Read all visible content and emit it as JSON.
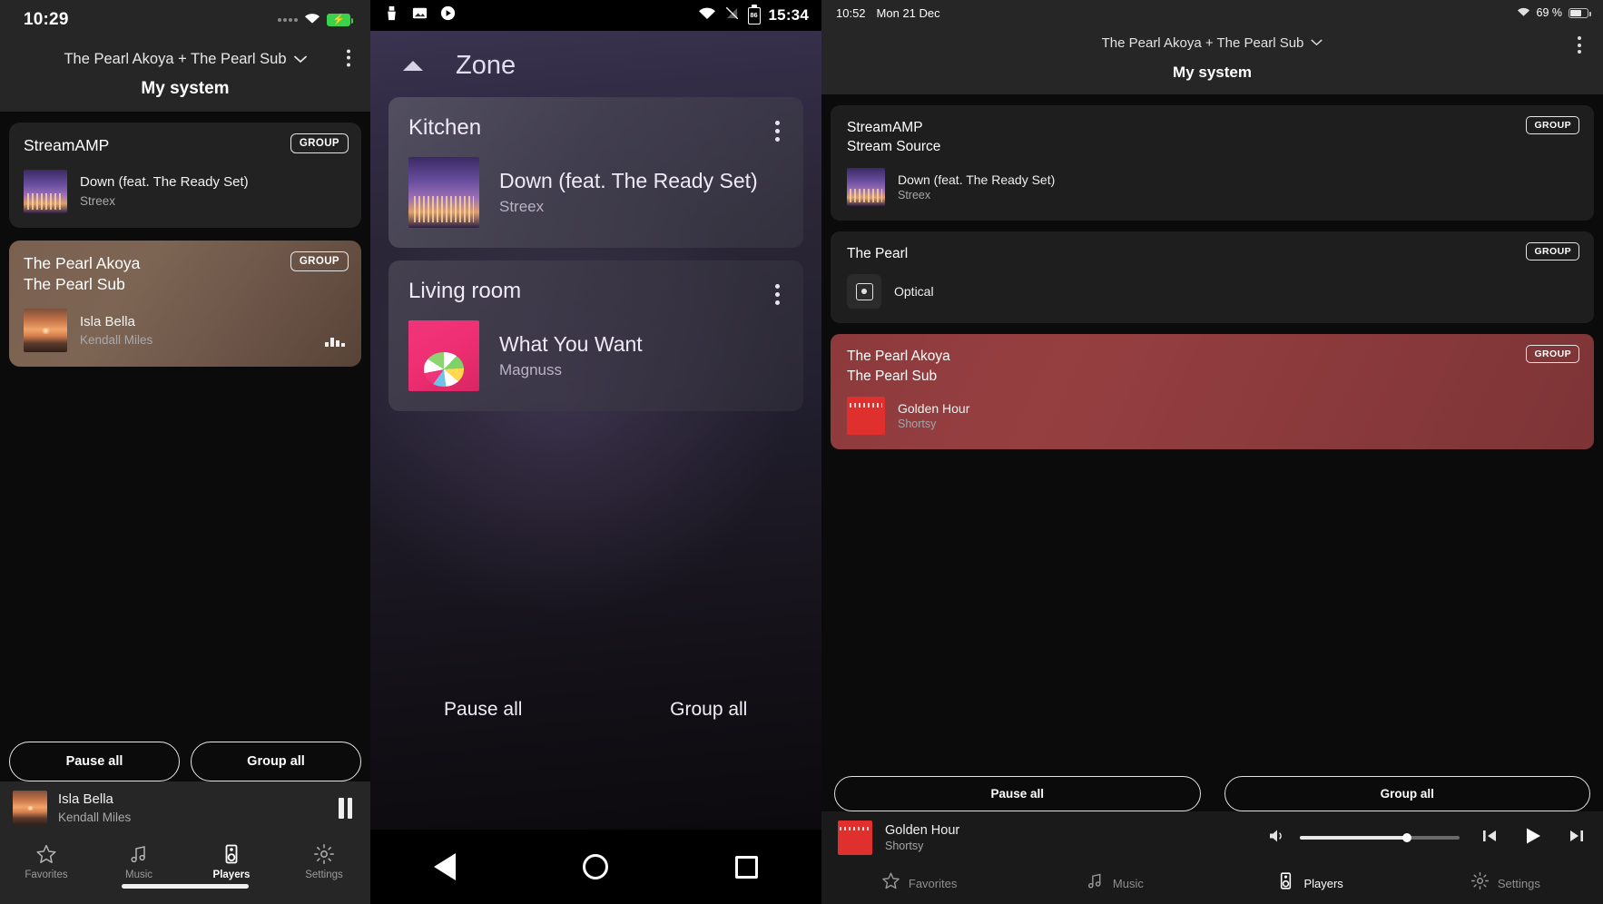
{
  "panel1": {
    "status": {
      "clock": "10:29",
      "wifi_icon": "wifi-icon",
      "signal_icon": "signal-dots-icon",
      "battery_icon": "battery-charging-icon"
    },
    "header": {
      "system_selector": "The Pearl Akoya + The Pearl Sub",
      "chevron": "⌄",
      "menu_icon": "kebab-menu-icon",
      "page_title": "My system"
    },
    "cards": [
      {
        "name": "StreamAMP",
        "group_label": "GROUP",
        "now_playing": {
          "title": "Down (feat. The Ready Set)",
          "artist": "Streex",
          "artwork": "city-skyline-artwork"
        },
        "playing": false
      },
      {
        "name_line1": "The Pearl Akoya",
        "name_line2": "The Pearl Sub",
        "group_label": "GROUP",
        "now_playing": {
          "title": "Isla Bella",
          "artist": "Kendall Miles",
          "artwork": "sunset-artwork"
        },
        "playing": true,
        "eq_icon": "equalizer-bars-icon"
      }
    ],
    "actions": {
      "pause_all": "Pause all",
      "group_all": "Group all"
    },
    "mini_player": {
      "title": "Isla Bella",
      "artist": "Kendall Miles",
      "artwork": "sunset-artwork",
      "pause_icon": "pause-icon"
    },
    "tabs": [
      {
        "label": "Favorites",
        "icon": "star-icon",
        "active": false
      },
      {
        "label": "Music",
        "icon": "music-note-icon",
        "active": false
      },
      {
        "label": "Players",
        "icon": "speaker-icon",
        "active": true
      },
      {
        "label": "Settings",
        "icon": "gear-icon",
        "active": false
      }
    ]
  },
  "panel2": {
    "status": {
      "time": "15:34",
      "battery_level": "86",
      "icons": [
        "cleaner-icon",
        "image-icon",
        "play-circle-icon"
      ],
      "right_icons": [
        "wifi-icon",
        "sim-off-icon"
      ]
    },
    "header": {
      "collapse_icon": "caret-up-icon",
      "title": "Zone"
    },
    "zones": [
      {
        "name": "Kitchen",
        "menu_icon": "kebab-menu-icon",
        "now_playing": {
          "title": "Down (feat. The Ready Set)",
          "artist": "Streex",
          "artwork": "city-skyline-artwork"
        }
      },
      {
        "name": "Living room",
        "menu_icon": "kebab-menu-icon",
        "now_playing": {
          "title": "What You Want",
          "artist": "Magnuss",
          "artwork": "lollipop-pink-artwork"
        }
      }
    ],
    "actions": {
      "pause_all": "Pause all",
      "group_all": "Group all"
    },
    "navbar": {
      "back_icon": "triangle-back-icon",
      "home_icon": "circle-home-icon",
      "recents_icon": "square-recents-icon"
    }
  },
  "panel3": {
    "status": {
      "time": "10:52",
      "date": "Mon 21 Dec",
      "wifi_icon": "wifi-icon",
      "battery_percent": "69 %",
      "battery_icon": "battery-icon"
    },
    "header": {
      "system_selector": "The Pearl Akoya + The Pearl Sub",
      "chevron": "⌄",
      "menu_icon": "kebab-menu-icon",
      "page_title": "My system"
    },
    "cards": [
      {
        "name_line1": "StreamAMP",
        "name_line2": "Stream Source",
        "group_label": "GROUP",
        "now_playing": {
          "title": "Down (feat. The Ready Set)",
          "artist": "Streex",
          "artwork": "city-skyline-artwork"
        },
        "selected": false
      },
      {
        "name_line1": "The Pearl",
        "group_label": "GROUP",
        "source": {
          "label": "Optical",
          "icon": "optical-input-icon"
        },
        "selected": false
      },
      {
        "name_line1": "The Pearl Akoya",
        "name_line2": "The Pearl Sub",
        "group_label": "GROUP",
        "now_playing": {
          "title": "Golden Hour",
          "artist": "Shortsy",
          "artwork": "red-artwork"
        },
        "selected": true
      }
    ],
    "actions": {
      "pause_all": "Pause all",
      "group_all": "Group all"
    },
    "player": {
      "title": "Golden Hour",
      "artist": "Shortsy",
      "artwork": "red-artwork",
      "volume_icon": "speaker-volume-icon",
      "volume_percent": 67,
      "prev_icon": "skip-previous-icon",
      "play_icon": "play-icon",
      "next_icon": "skip-next-icon"
    },
    "tabs": [
      {
        "label": "Favorites",
        "icon": "star-icon",
        "active": false
      },
      {
        "label": "Music",
        "icon": "music-note-icon",
        "active": false
      },
      {
        "label": "Players",
        "icon": "speaker-icon",
        "active": true
      },
      {
        "label": "Settings",
        "icon": "gear-icon",
        "active": false
      }
    ]
  }
}
